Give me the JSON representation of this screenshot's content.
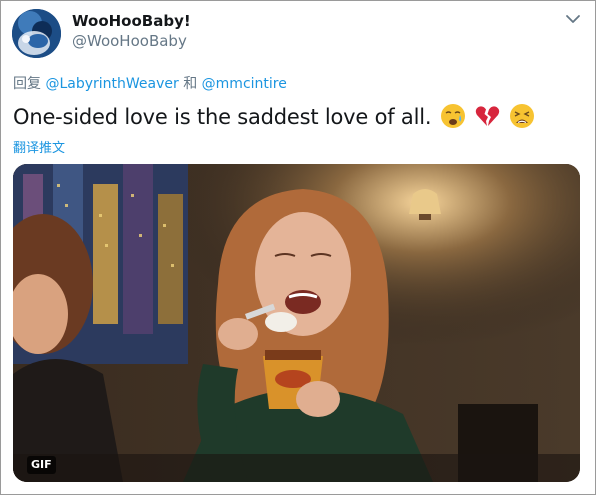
{
  "header": {
    "display_name": "WooHooBaby!",
    "handle": "@WooHooBaby",
    "avatar_icon": "avatar-image",
    "menu_icon": "chevron-down-icon"
  },
  "reply": {
    "prefix": "回复",
    "mention_1": "@LabyrinthWeaver",
    "conjunction": "和",
    "mention_2": "@mmcintire"
  },
  "tweet": {
    "text": "One-sided love is the saddest love of all.",
    "emojis": [
      "crying-face-emoji",
      "broken-heart-emoji",
      "weary-face-emoji"
    ],
    "translate_label": "翻译推文"
  },
  "media": {
    "type": "gif",
    "badge_label": "GIF",
    "description_icon": "gif-media"
  },
  "colors": {
    "link": "#1b95e0",
    "secondary_text": "#657786",
    "primary_text": "#14171a"
  }
}
